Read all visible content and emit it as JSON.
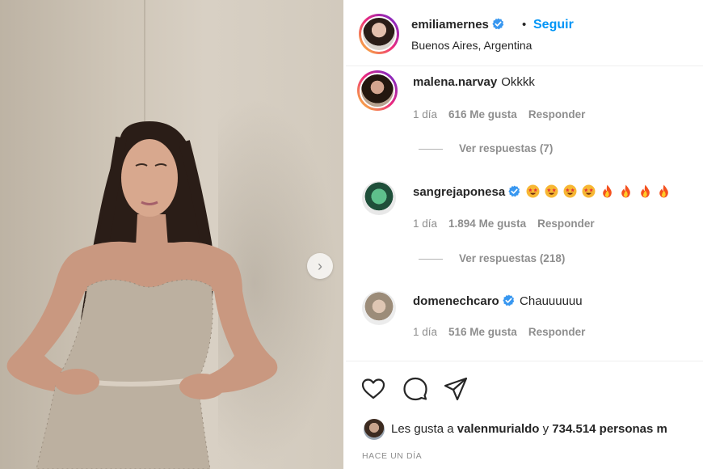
{
  "post": {
    "username": "emiliamernes",
    "separator": "•",
    "follow_label": "Seguir",
    "location": "Buenos Aires, Argentina"
  },
  "comments": [
    {
      "username": "malena.narvay",
      "text": "Okkkk",
      "time": "1 día",
      "likes": "616 Me gusta",
      "reply_label": "Responder",
      "view_replies": "Ver respuestas (7)",
      "verified": false
    },
    {
      "username": "sangrejaponesa",
      "text": "",
      "emojis": [
        "star-struck",
        "star-struck",
        "star-struck",
        "star-struck",
        "fire",
        "fire",
        "fire",
        "fire"
      ],
      "time": "1 día",
      "likes": "1.894 Me gusta",
      "reply_label": "Responder",
      "view_replies": "Ver respuestas (218)",
      "verified": true
    },
    {
      "username": "domenechcaro",
      "text": "Chauuuuuu",
      "time": "1 día",
      "likes": "516 Me gusta",
      "reply_label": "Responder",
      "verified": true
    }
  ],
  "likes_bar": {
    "prefix": "Les gusta a",
    "user": "valenmurialdo",
    "middle": "y",
    "count": "734.514 personas m"
  },
  "time_ago": "HACE UN DÍA",
  "colors": {
    "accent": "#0095f6",
    "text": "#262626",
    "muted": "#8e8e8e"
  },
  "icons": [
    "heart-icon",
    "comment-icon",
    "share-icon",
    "verified-badge-icon",
    "next-arrow-icon"
  ]
}
